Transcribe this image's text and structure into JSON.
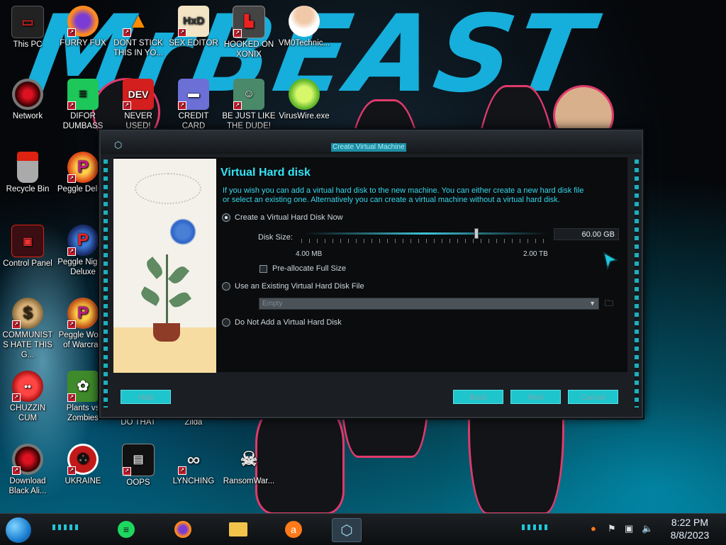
{
  "desktop": {
    "icons": [
      {
        "label": "This PC"
      },
      {
        "label": "FURRY FUX"
      },
      {
        "label": "DONT STICK THIS IN YO..."
      },
      {
        "label": "SEX EDITOR"
      },
      {
        "label": "HOOKED ON XONIX"
      },
      {
        "label": "VM0Technic..."
      },
      {
        "label": "Network"
      },
      {
        "label": "DIFOR DUMBASS"
      },
      {
        "label": "NEVER USED!"
      },
      {
        "label": "CREDIT CARD SNIFFER"
      },
      {
        "label": "BE JUST LIKE THE DUDE!"
      },
      {
        "label": "VirusWire.exe"
      },
      {
        "label": "Recycle Bin"
      },
      {
        "label": "Peggle Delu..."
      },
      {
        "label": "Control Panel"
      },
      {
        "label": "Peggle Nights Deluxe"
      },
      {
        "label": "COMMUNISTS HATE THIS G..."
      },
      {
        "label": "Peggle World of Warcraft"
      },
      {
        "label": "CHUZZIN CUM"
      },
      {
        "label": "Plants vs Zombies"
      },
      {
        "label": "DO THAT"
      },
      {
        "label": "Zilda"
      },
      {
        "label": "Download Black Ali..."
      },
      {
        "label": "UKRAINE"
      },
      {
        "label": "OOPS"
      },
      {
        "label": "LYNCHING"
      },
      {
        "label": "RansomWar..."
      }
    ]
  },
  "dialog": {
    "title": "Create Virtual Machine",
    "heading": "Virtual Hard disk",
    "description": "If you wish you can add a virtual hard disk to the new machine. You can either create a new hard disk file or select an existing one. Alternatively you can create a virtual machine without a virtual hard disk.",
    "options": {
      "create_now": "Create a Virtual Hard Disk Now",
      "use_existing": "Use an Existing Virtual Hard Disk File",
      "do_not_add": "Do Not Add a Virtual Hard Disk"
    },
    "selected_option": "create_now",
    "disk_size": {
      "label": "Disk Size:",
      "value": "60.00 GB",
      "min_label": "4.00 MB",
      "max_label": "2.00 TB",
      "slider_position": 0.7
    },
    "preallocate": {
      "label": "Pre-allocate Full Size",
      "checked": false
    },
    "existing_disk_select": {
      "value": "Empty"
    },
    "buttons": {
      "help": "Help",
      "back": "Back",
      "next": "Next",
      "cancel": "Cancel"
    }
  },
  "taskbar": {
    "apps": [
      {
        "name": "Spotify",
        "icon": "spotify-icon"
      },
      {
        "name": "Firefox",
        "icon": "firefox-icon"
      },
      {
        "name": "File Explorer",
        "icon": "folder-icon"
      },
      {
        "name": "Avast",
        "icon": "avast-icon"
      },
      {
        "name": "VirtualBox",
        "icon": "virtualbox-icon",
        "active": true
      }
    ],
    "clock": {
      "time": "8:22 PM",
      "date": "8/8/2023"
    }
  },
  "colors": {
    "accent": "#1fc5cc",
    "heading": "#35e3f5",
    "wallpaper_text": "#17b7e6"
  }
}
